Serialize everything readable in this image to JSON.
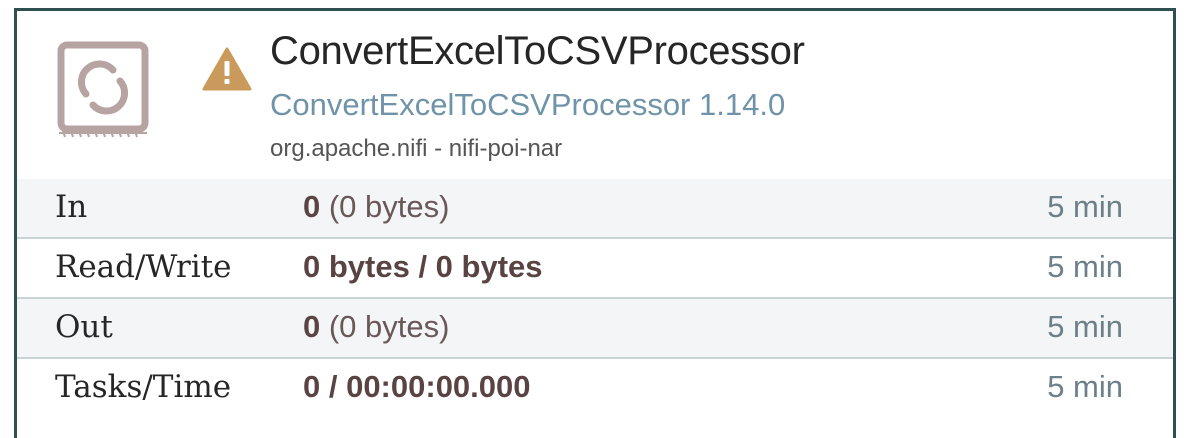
{
  "processor": {
    "name": "ConvertExcelToCSVProcessor",
    "type_version": "ConvertExcelToCSVProcessor 1.14.0",
    "bundle": "org.apache.nifi - nifi-poi-nar",
    "icon": "processor-icon",
    "status_icon": "warning-icon"
  },
  "stats": [
    {
      "label": "In",
      "value_bold": "0",
      "value_normal": " (0 bytes)",
      "window": "5 min"
    },
    {
      "label": "Read/Write",
      "value_bold": "0 bytes / 0 bytes",
      "value_normal": "",
      "window": "5 min"
    },
    {
      "label": "Out",
      "value_bold": "0",
      "value_normal": " (0 bytes)",
      "window": "5 min"
    },
    {
      "label": "Tasks/Time",
      "value_bold": "0 / 00:00:00.000",
      "value_normal": "",
      "window": "5 min"
    }
  ],
  "colors": {
    "border": "#2f5050",
    "warning": "#c99a5b",
    "subtitle": "#6f93a8",
    "icon": "#b8a3a3"
  }
}
